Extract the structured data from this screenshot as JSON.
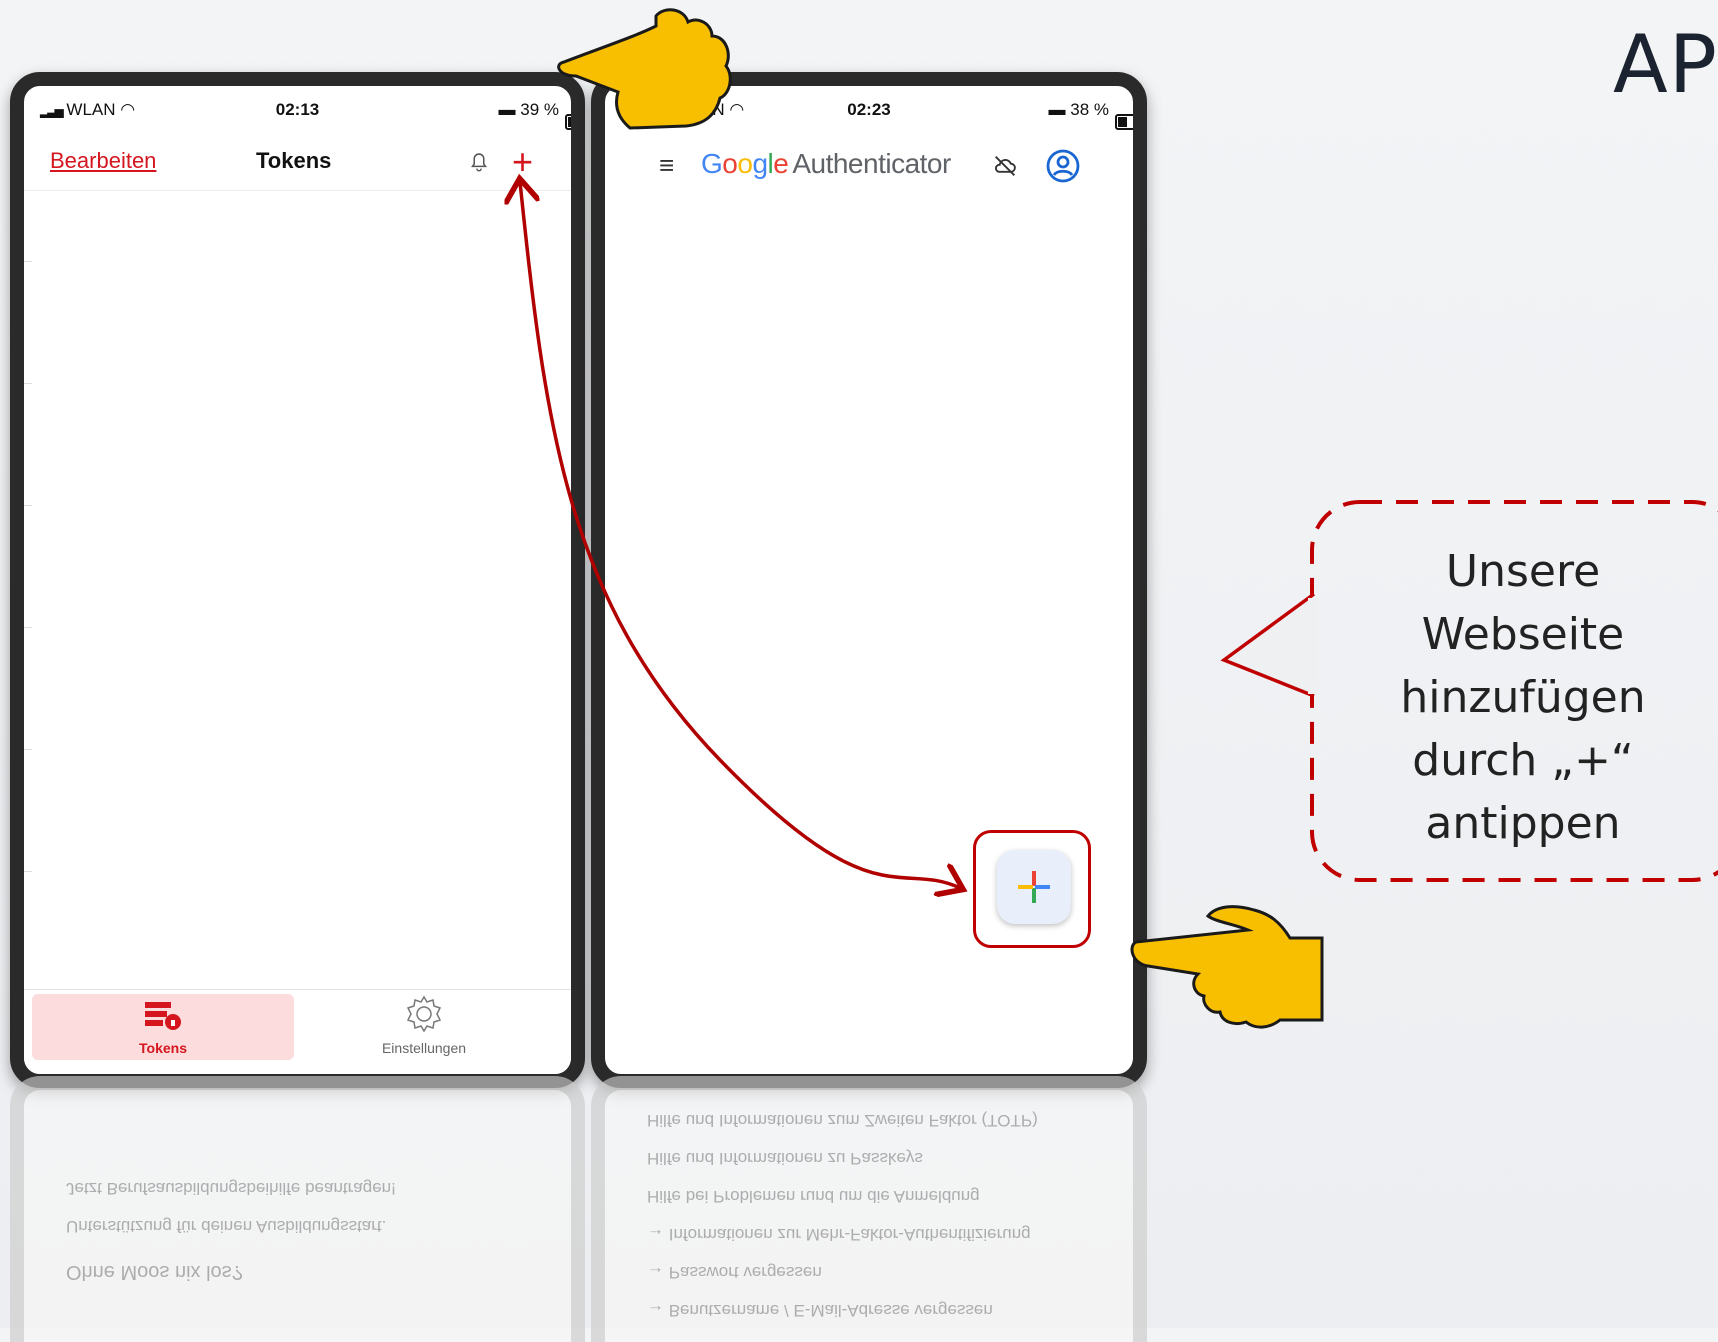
{
  "corner_heading": "AP",
  "left_phone": {
    "status": {
      "carrier": "WLAN",
      "time": "02:13",
      "battery": "39 %"
    },
    "nav": {
      "edit": "Bearbeiten",
      "title": "Tokens"
    },
    "tabs": [
      {
        "label": "Tokens"
      },
      {
        "label": "Einstellungen"
      }
    ],
    "reflection_lines": [
      "Jetzt Berufsausbildungsbeihilfe beantragen!",
      "Unterstützung für deinen Ausbildungsstart.",
      "Ohne Moos nix los?"
    ]
  },
  "right_phone": {
    "status": {
      "carrier": "AN",
      "time": "02:23",
      "battery": "38 %"
    },
    "app_name": {
      "google": "Google",
      "authenticator": "Authenticator"
    },
    "reflection_lines": [
      "Hilfe und Informationen zum Zweiten Faktor (TOTP)",
      "Hilfe und Informationen zu Passkeys",
      "Hilfe bei Problemen rund um die Anmeldung",
      "→ Informationen zur Mehr-Faktor-Authentifizierung",
      "→ Passwort vergessen",
      "→ Benutzername / E-Mail-Adresse vergessen"
    ]
  },
  "callout": {
    "lines": [
      "Unsere",
      "Webseite",
      "hinzufügen",
      "durch „+“",
      "antippen"
    ]
  },
  "colors": {
    "accent_red": "#d5161e",
    "annotation_red": "#b00000",
    "hand_yellow": "#f7bf00"
  },
  "icons": [
    "bell-icon",
    "plus-icon",
    "menu-icon",
    "cloud-off-icon",
    "account-circle-icon",
    "tokens-icon",
    "gear-icon",
    "pointing-hand-icon"
  ]
}
